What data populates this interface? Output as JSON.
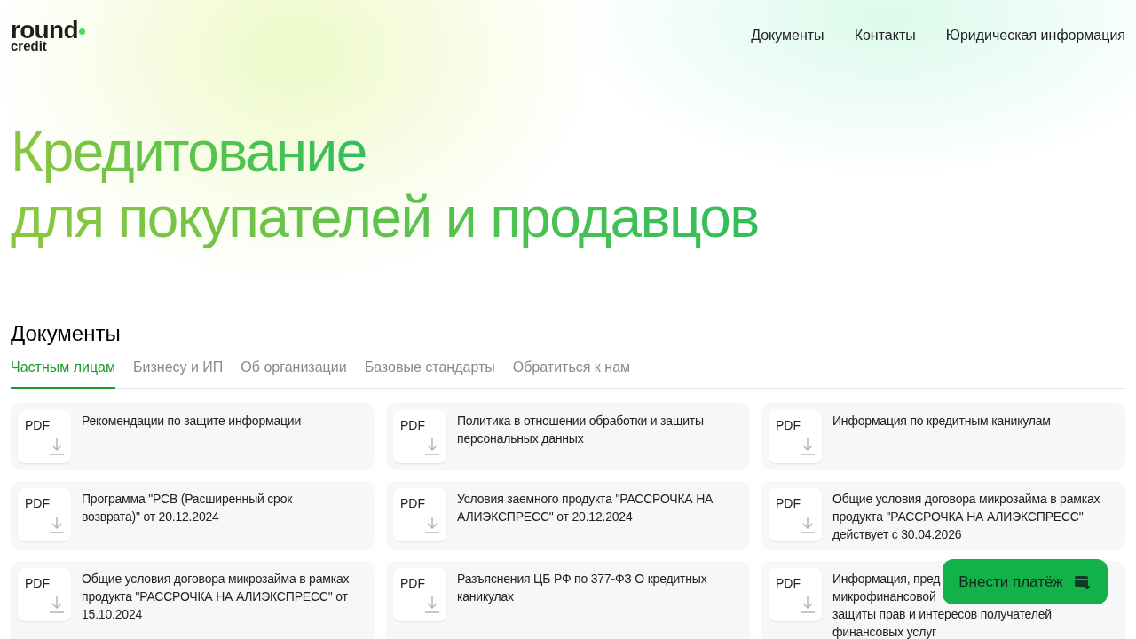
{
  "logo": {
    "word": "round",
    "sub": "credit"
  },
  "nav": [
    "Документы",
    "Контакты",
    "Юридическая информация"
  ],
  "hero": {
    "lines": [
      "Кредитование",
      "для покупателей и продавцов"
    ]
  },
  "documents": {
    "title": "Документы",
    "tabs": [
      {
        "label": "Частным лицам",
        "selected": true
      },
      {
        "label": "Бизнесу и ИП",
        "selected": false
      },
      {
        "label": "Об организации",
        "selected": false
      },
      {
        "label": "Базовые стандарты",
        "selected": false
      },
      {
        "label": "Обратиться к нам",
        "selected": false
      }
    ],
    "items": [
      {
        "badge": "PDF",
        "lines": [
          "Рекомендации по защите информации"
        ]
      },
      {
        "badge": "PDF",
        "lines": [
          "Политика в отношении обработки и защиты",
          "персональных данных"
        ]
      },
      {
        "badge": "PDF",
        "lines": [
          "Информация по кредитным каникулам"
        ]
      },
      {
        "badge": "PDF",
        "lines": [
          "Программа \"РСВ (Расширенный срок",
          "возврата)\" от 20.12.2024"
        ]
      },
      {
        "badge": "PDF",
        "lines": [
          "Условия заемного продукта \"РАССРОЧКА НА",
          "АЛИЭКСПРЕСС\" от 20.12.2024"
        ]
      },
      {
        "badge": "PDF",
        "lines": [
          "Общие условия договора микрозайма в рамках",
          "продукта \"РАССРОЧКА НА АЛИЭКСПРЕСС\"",
          "действует с 30.04.2026"
        ]
      },
      {
        "badge": "PDF",
        "lines": [
          "Общие условия договора микрозайма в рамках",
          "продукта \"РАССРОЧКА НА АЛИЭКСПРЕСС\" от",
          "15.10.2024"
        ]
      },
      {
        "badge": "PDF",
        "lines": [
          "Разъяснения ЦБ РФ по 377-ФЗ О кредитных",
          "каникулах"
        ]
      },
      {
        "badge": "PDF",
        "lines": [
          "Информация, пред",
          "микрофинансовой",
          "защиты прав и интересов получателей",
          "финансовых услуг"
        ]
      }
    ]
  },
  "pay_button": {
    "label": "Внести платёж"
  }
}
